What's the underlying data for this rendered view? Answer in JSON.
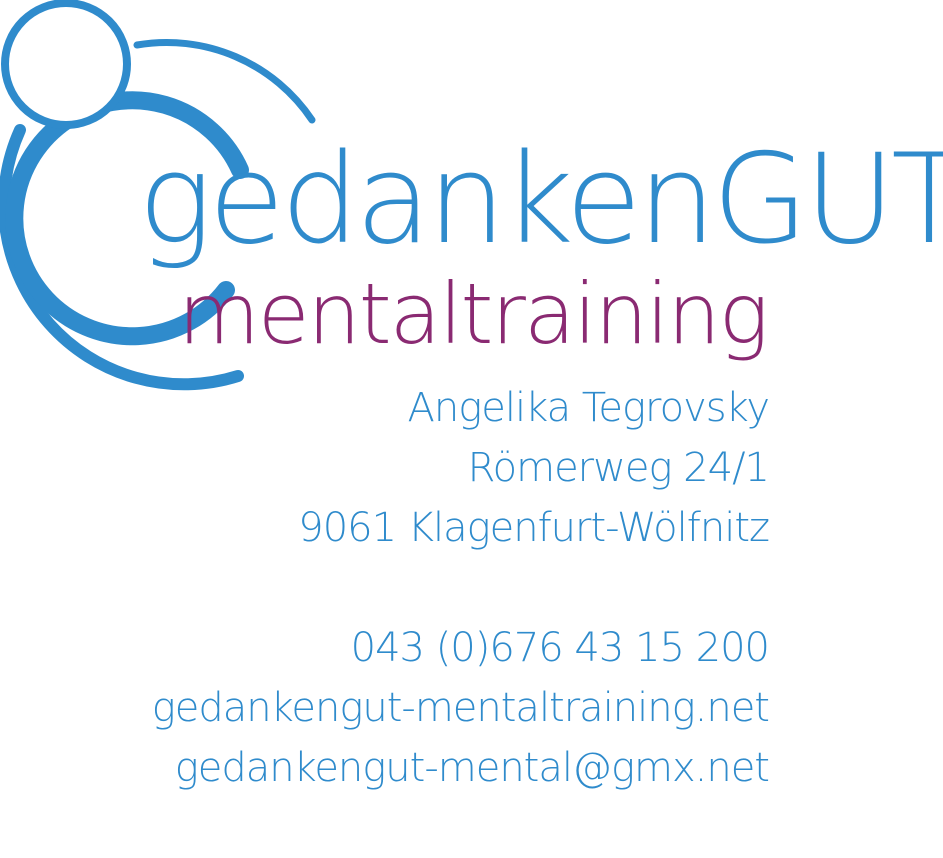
{
  "colors": {
    "brand_blue": "#2f8bcc",
    "brand_purple": "#8a2a72",
    "background": "#ffffff"
  },
  "logo": {
    "icon": "stylized-person-circles-icon",
    "brand_name": "gedankenGUT",
    "tagline": "mentaltraining"
  },
  "contact": {
    "name": "Angelika Tegrovsky",
    "street": "Römerweg 24/1",
    "city": "9061 Klagenfurt-Wölfnitz",
    "phone": "043 (0)676 43 15 200",
    "website": "gedankengut-mentaltraining.net",
    "email": "gedankengut-mental@gmx.net"
  }
}
